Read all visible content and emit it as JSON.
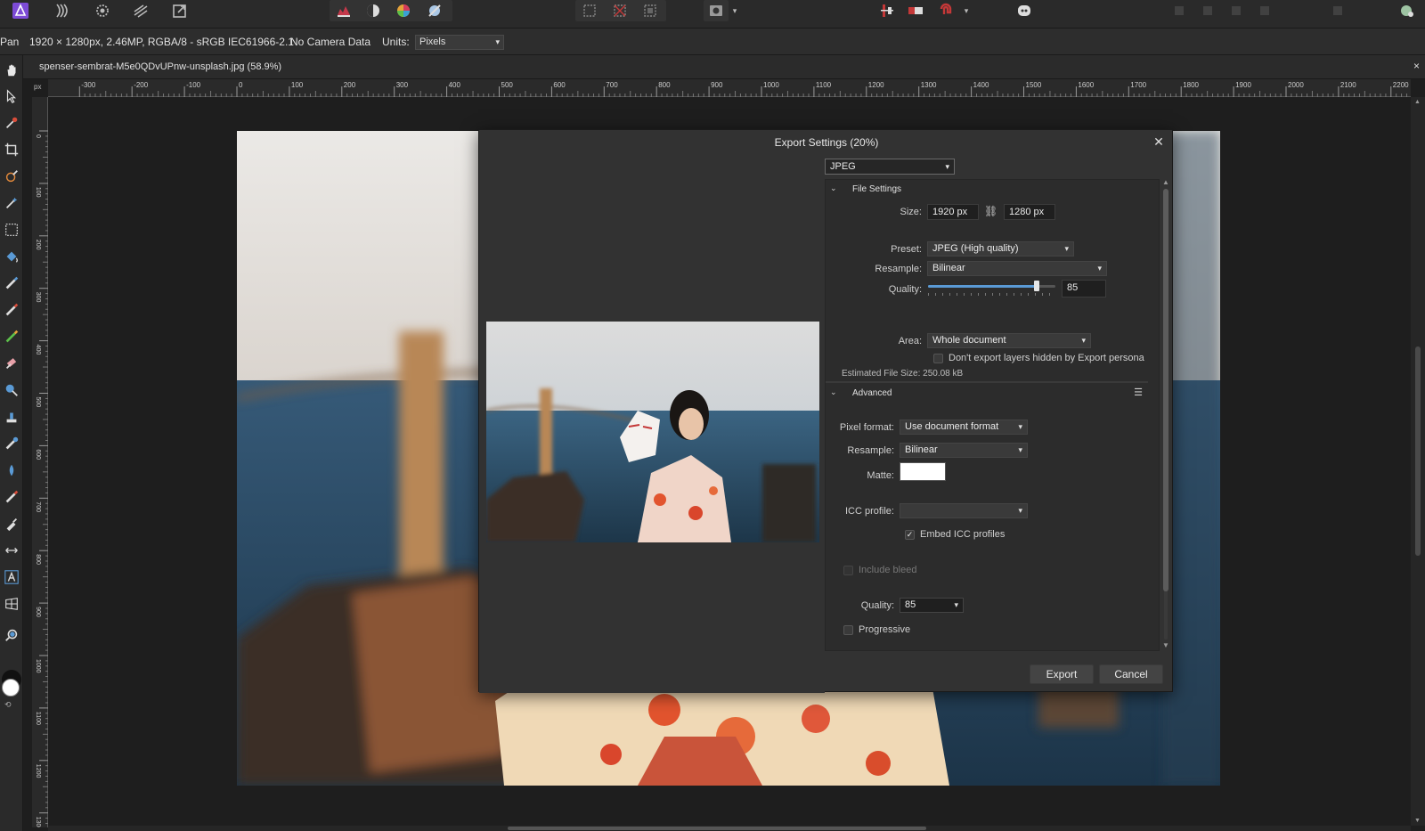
{
  "context_bar": {
    "tool_name": "Pan",
    "doc_info": "1920 × 1280px, 2.46MP, RGBA/8 - sRGB IEC61966-2.1",
    "camera": "No Camera Data",
    "units_label": "Units:",
    "units_value": "Pixels"
  },
  "document": {
    "tab_title": "spenser-sembrat-M5e0QDvUPnw-unsplash.jpg (58.9%)",
    "close": "×"
  },
  "rulers": {
    "unit": "px",
    "h_ticks": [
      "-300",
      "-200",
      "-100",
      "0",
      "100",
      "200",
      "300",
      "400",
      "500",
      "600",
      "700",
      "800",
      "900",
      "1000",
      "1100",
      "1200",
      "1300",
      "1400",
      "1500",
      "1600",
      "1700",
      "1800",
      "1900",
      "2000",
      "2100",
      "2200"
    ],
    "v_ticks": [
      "0",
      "100",
      "200",
      "300",
      "400",
      "500",
      "600",
      "700",
      "800",
      "900",
      "1000",
      "1100",
      "1200",
      "1300"
    ]
  },
  "dialog": {
    "title": "Export Settings (20%)",
    "close": "✕",
    "format": "JPEG",
    "file_settings": {
      "header": "File Settings",
      "size_label": "Size:",
      "width": "1920 px",
      "height": "1280 px",
      "preset_label": "Preset:",
      "preset_value": "JPEG (High quality)",
      "resample_label": "Resample:",
      "resample_value": "Bilinear",
      "quality_label": "Quality:",
      "quality_value": "85",
      "quality_fraction": 0.85,
      "area_label": "Area:",
      "area_value": "Whole document",
      "hidden_layers_label": "Don't export layers hidden by Export persona",
      "est_size": "Estimated File Size: 250.08 kB"
    },
    "advanced": {
      "header": "Advanced",
      "pixel_format_label": "Pixel format:",
      "pixel_format_value": "Use document format",
      "resample_label": "Resample:",
      "resample_value": "Bilinear",
      "matte_label": "Matte:",
      "icc_label": "ICC profile:",
      "icc_value": "",
      "embed_icc_label": "Embed ICC profiles",
      "include_bleed_label": "Include bleed",
      "quality_label": "Quality:",
      "quality_value": "85",
      "progressive_label": "Progressive"
    },
    "buttons": {
      "export": "Export",
      "cancel": "Cancel"
    }
  },
  "colors": {
    "accent": "#5a9ad5",
    "app_icon": "#7d4bd6"
  }
}
